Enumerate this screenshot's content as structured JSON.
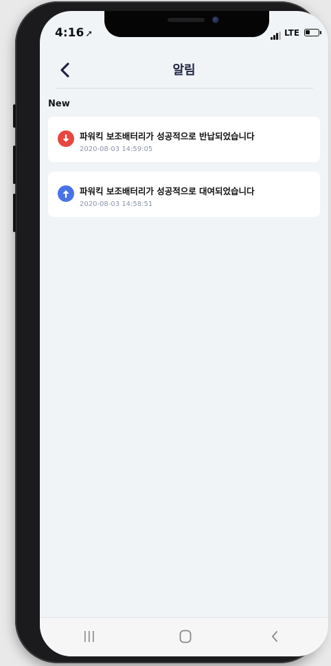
{
  "status_bar": {
    "time": "4:16",
    "network": "LTE"
  },
  "header": {
    "title": "알림"
  },
  "section": {
    "label": "New"
  },
  "notifications": [
    {
      "title": "파워킥 보조배터리가 성공적으로 반납되었습니다",
      "timestamp": "2020-08-03 14:59:05",
      "icon": "arrow-down-circle-icon",
      "color": "#e8473f"
    },
    {
      "title": "파워킥 보조배터리가 성공적으로 대여되었습니다",
      "timestamp": "2020-08-03 14:58:51",
      "icon": "arrow-up-circle-icon",
      "color": "#4a72e8"
    }
  ],
  "nav_bar": {
    "items": [
      "recent-apps-icon",
      "home-icon",
      "back-icon"
    ]
  },
  "colors": {
    "background": "#f1f4f7",
    "title": "#1e2540",
    "return_icon": "#e8473f",
    "rental_icon": "#4a72e8"
  }
}
